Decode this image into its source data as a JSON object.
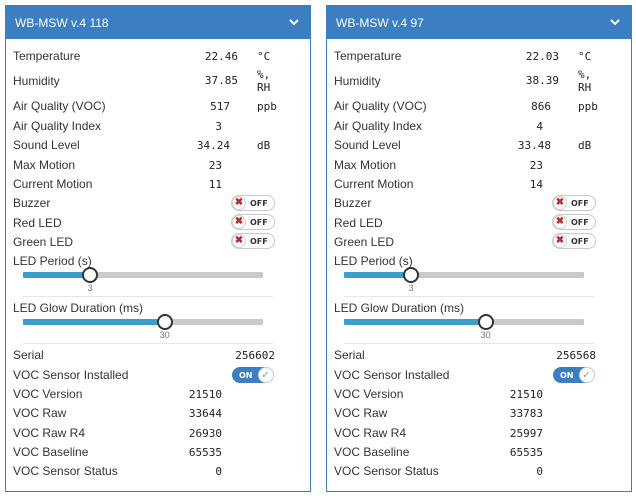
{
  "panels": [
    {
      "title": "WB-MSW v.4 118",
      "temperature": {
        "label": "Temperature",
        "value": "22.46",
        "unit": "°C"
      },
      "humidity": {
        "label": "Humidity",
        "value": "37.85",
        "unit_line1": "%,",
        "unit_line2": "RH"
      },
      "air_quality_voc": {
        "label": "Air Quality (VOC)",
        "value": "517",
        "unit": "ppb"
      },
      "air_quality_index": {
        "label": "Air Quality Index",
        "value": "3"
      },
      "sound_level": {
        "label": "Sound Level",
        "value": "34.24",
        "unit": "dB"
      },
      "max_motion": {
        "label": "Max Motion",
        "value": "23"
      },
      "current_motion": {
        "label": "Current Motion",
        "value": "11"
      },
      "buzzer": {
        "label": "Buzzer",
        "state": "OFF"
      },
      "red_led": {
        "label": "Red LED",
        "state": "OFF"
      },
      "green_led": {
        "label": "Green LED",
        "state": "OFF"
      },
      "led_period": {
        "label": "LED Period (s)",
        "value": "3",
        "fraction": 0.28
      },
      "led_glow": {
        "label": "LED Glow Duration (ms)",
        "value": "30",
        "fraction": 0.59
      },
      "serial": {
        "label": "Serial",
        "value": "256602"
      },
      "voc_installed": {
        "label": "VOC Sensor Installed",
        "state": "ON"
      },
      "voc_version": {
        "label": "VOC Version",
        "value": "21510"
      },
      "voc_raw": {
        "label": "VOC Raw",
        "value": "33644"
      },
      "voc_raw_r4": {
        "label": "VOC Raw R4",
        "value": "26930"
      },
      "voc_baseline": {
        "label": "VOC Baseline",
        "value": "65535"
      },
      "voc_status": {
        "label": "VOC Sensor Status",
        "value": "0"
      }
    },
    {
      "title": "WB-MSW v.4 97",
      "temperature": {
        "label": "Temperature",
        "value": "22.03",
        "unit": "°C"
      },
      "humidity": {
        "label": "Humidity",
        "value": "38.39",
        "unit_line1": "%,",
        "unit_line2": "RH"
      },
      "air_quality_voc": {
        "label": "Air Quality (VOC)",
        "value": "866",
        "unit": "ppb"
      },
      "air_quality_index": {
        "label": "Air Quality Index",
        "value": "4"
      },
      "sound_level": {
        "label": "Sound Level",
        "value": "33.48",
        "unit": "dB"
      },
      "max_motion": {
        "label": "Max Motion",
        "value": "23"
      },
      "current_motion": {
        "label": "Current Motion",
        "value": "14"
      },
      "buzzer": {
        "label": "Buzzer",
        "state": "OFF"
      },
      "red_led": {
        "label": "Red LED",
        "state": "OFF"
      },
      "green_led": {
        "label": "Green LED",
        "state": "OFF"
      },
      "led_period": {
        "label": "LED Period (s)",
        "value": "3",
        "fraction": 0.28
      },
      "led_glow": {
        "label": "LED Glow Duration (ms)",
        "value": "30",
        "fraction": 0.59
      },
      "serial": {
        "label": "Serial",
        "value": "256568"
      },
      "voc_installed": {
        "label": "VOC Sensor Installed",
        "state": "ON"
      },
      "voc_version": {
        "label": "VOC Version",
        "value": "21510"
      },
      "voc_raw": {
        "label": "VOC Raw",
        "value": "33783"
      },
      "voc_raw_r4": {
        "label": "VOC Raw R4",
        "value": "25997"
      },
      "voc_baseline": {
        "label": "VOC Baseline",
        "value": "65535"
      },
      "voc_status": {
        "label": "VOC Sensor Status",
        "value": "0"
      }
    }
  ],
  "icons": {
    "collapse": "chevron-down-icon",
    "switch_off": "close-icon",
    "switch_on": "check-icon"
  },
  "colors": {
    "header": "#3b7ec2",
    "slider_fill": "#3b9fc7",
    "switch_on": "#3b7ec2",
    "off_icon": "#c0282d"
  }
}
